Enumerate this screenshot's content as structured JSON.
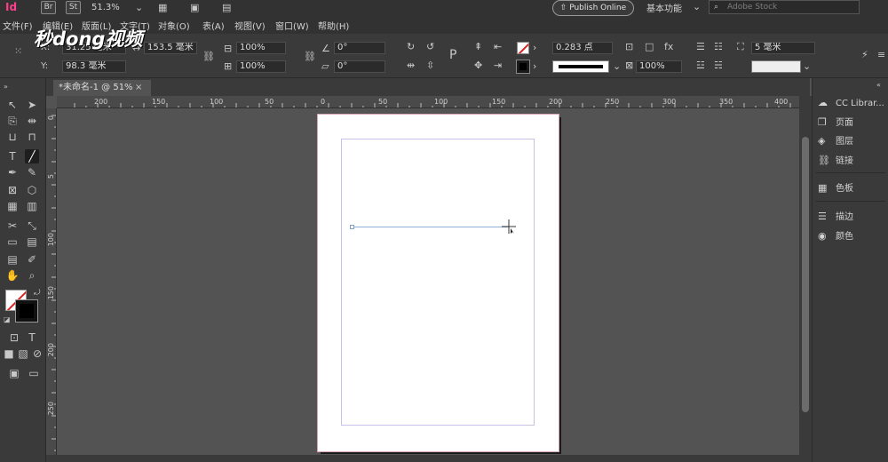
{
  "menubar": {
    "app_badge": "Id",
    "br_badge": "Br",
    "st_badge": "St",
    "zoom": "51.3%",
    "items": [
      "文件(F)",
      "编辑(E)",
      "版面(L)",
      "文字(T)",
      "对象(O)",
      "表(A)",
      "视图(V)",
      "窗口(W)",
      "帮助(H)"
    ],
    "publish_label": "Publish Online",
    "workspace_label": "基本功能",
    "search_placeholder": "Adobe Stock"
  },
  "watermark": {
    "logo_text": "秒dong视频"
  },
  "control": {
    "x_label": "X:",
    "x_value": "31.25 毫米",
    "y_label": "Y:",
    "y_value": "98.3 毫米",
    "w_value": "153.5 毫米",
    "scale_x": "100%",
    "scale_y": "100%",
    "rotate": "0°",
    "shear": "0°",
    "stroke_weight": "0.283 点",
    "opacity": "100%",
    "offset": "5 毫米"
  },
  "document": {
    "tab_label": "*未命名-1 @ 51%",
    "close_label": "×"
  },
  "ruler_h": [
    "200",
    "150",
    "100",
    "50",
    "0",
    "50",
    "100",
    "150",
    "200",
    "250",
    "300",
    "350",
    "400"
  ],
  "ruler_v": [
    "0",
    "5",
    "100",
    "150",
    "200",
    "250"
  ],
  "panels": {
    "items": [
      {
        "label": "CC Librar...",
        "icon": "cc-libraries-icon"
      },
      {
        "label": "页面",
        "icon": "pages-icon"
      },
      {
        "label": "图层",
        "icon": "layers-icon"
      },
      {
        "label": "链接",
        "icon": "links-icon"
      },
      {
        "label": "色板",
        "icon": "swatches-icon"
      },
      {
        "label": "描边",
        "icon": "stroke-icon"
      },
      {
        "label": "颜色",
        "icon": "color-icon"
      }
    ]
  },
  "colors": {
    "accent": "#ff3e8c",
    "page_outline": "#d6a7b3",
    "margin": "#c8c0e6",
    "line": "#8fb0d8"
  }
}
